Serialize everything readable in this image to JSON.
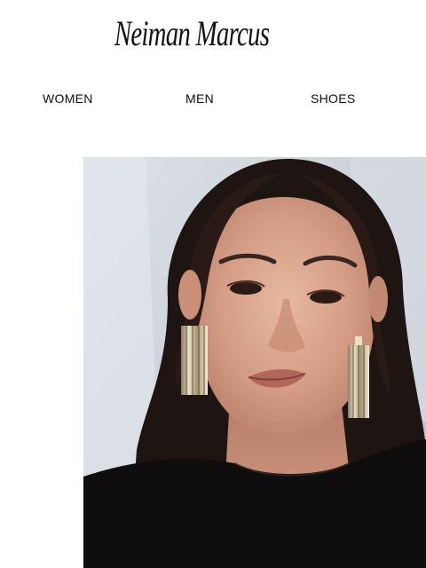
{
  "brand": {
    "logo_text": "Neiman Marcus"
  },
  "nav": {
    "items": [
      {
        "label": "WOMEN"
      },
      {
        "label": "MEN"
      },
      {
        "label": "SHOES"
      }
    ]
  },
  "hero": {
    "icon": "model-photo"
  },
  "colors": {
    "background": "#ffffff",
    "text": "#111111",
    "hero_backdrop": "#cfd5dc"
  }
}
